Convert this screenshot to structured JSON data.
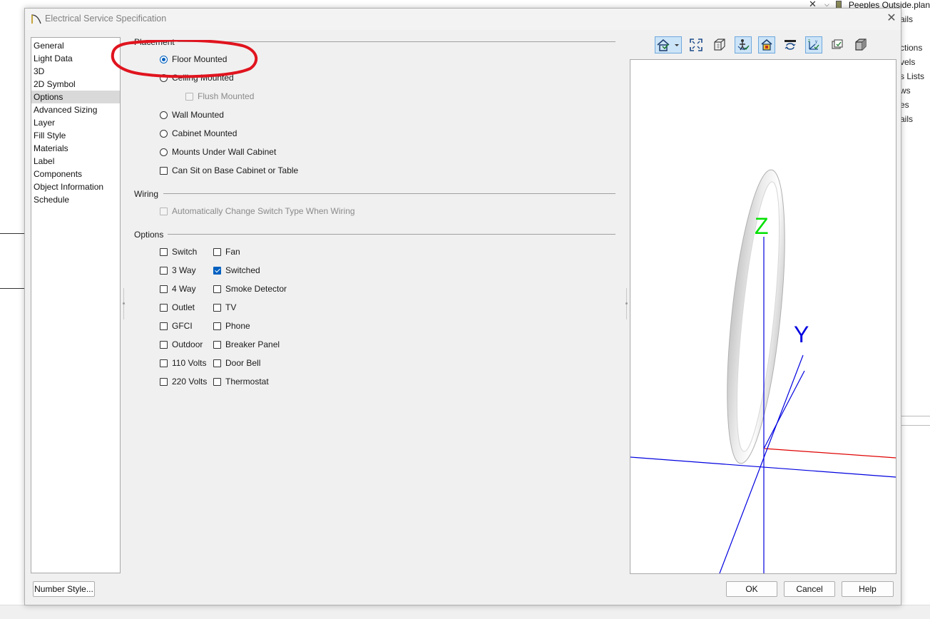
{
  "background_app": {
    "file_tab_title": "Peeples Outside.plan",
    "tree_items": [
      "ails",
      "ctions",
      "vels",
      "s Lists",
      "ws",
      "es",
      "ails"
    ]
  },
  "dialog": {
    "title": "Electrical Service Specification",
    "nav": {
      "items": [
        "General",
        "Light Data",
        "3D",
        "2D Symbol",
        "Options",
        "Advanced Sizing",
        "Layer",
        "Fill Style",
        "Materials",
        "Label",
        "Components",
        "Object Information",
        "Schedule"
      ],
      "selected": "Options"
    },
    "placement": {
      "label": "Placement",
      "floor_mounted": "Floor Mounted",
      "ceiling_mounted": "Ceiling Mounted",
      "flush_mounted": "Flush Mounted",
      "wall_mounted": "Wall Mounted",
      "cabinet_mounted": "Cabinet Mounted",
      "mounts_under_wall_cabinet": "Mounts Under Wall Cabinet",
      "can_sit_on_base_cabinet": "Can Sit on Base Cabinet or Table",
      "selected": "Floor Mounted"
    },
    "wiring": {
      "label": "Wiring",
      "auto_change_switch": "Automatically Change Switch Type When Wiring"
    },
    "options": {
      "label": "Options",
      "left": [
        "Switch",
        "3 Way",
        "4 Way",
        "Outlet",
        "GFCI",
        "Outdoor",
        "110 Volts",
        "220 Volts"
      ],
      "right": [
        "Fan",
        "Switched",
        "Smoke Detector",
        "TV",
        "Phone",
        "Breaker Panel",
        "Door Bell",
        "Thermostat"
      ],
      "checked": [
        "Switched"
      ]
    },
    "preview": {
      "axis_z": "Z",
      "axis_y": "Y"
    },
    "buttons": {
      "number_style": "Number Style...",
      "ok": "OK",
      "cancel": "Cancel",
      "help": "Help"
    },
    "colors": {
      "accent": "#0060c0",
      "annotation": "#e0141e",
      "axis_z": "#00e000",
      "axis_y": "#0000e0",
      "axis_x": "#e00000"
    }
  }
}
